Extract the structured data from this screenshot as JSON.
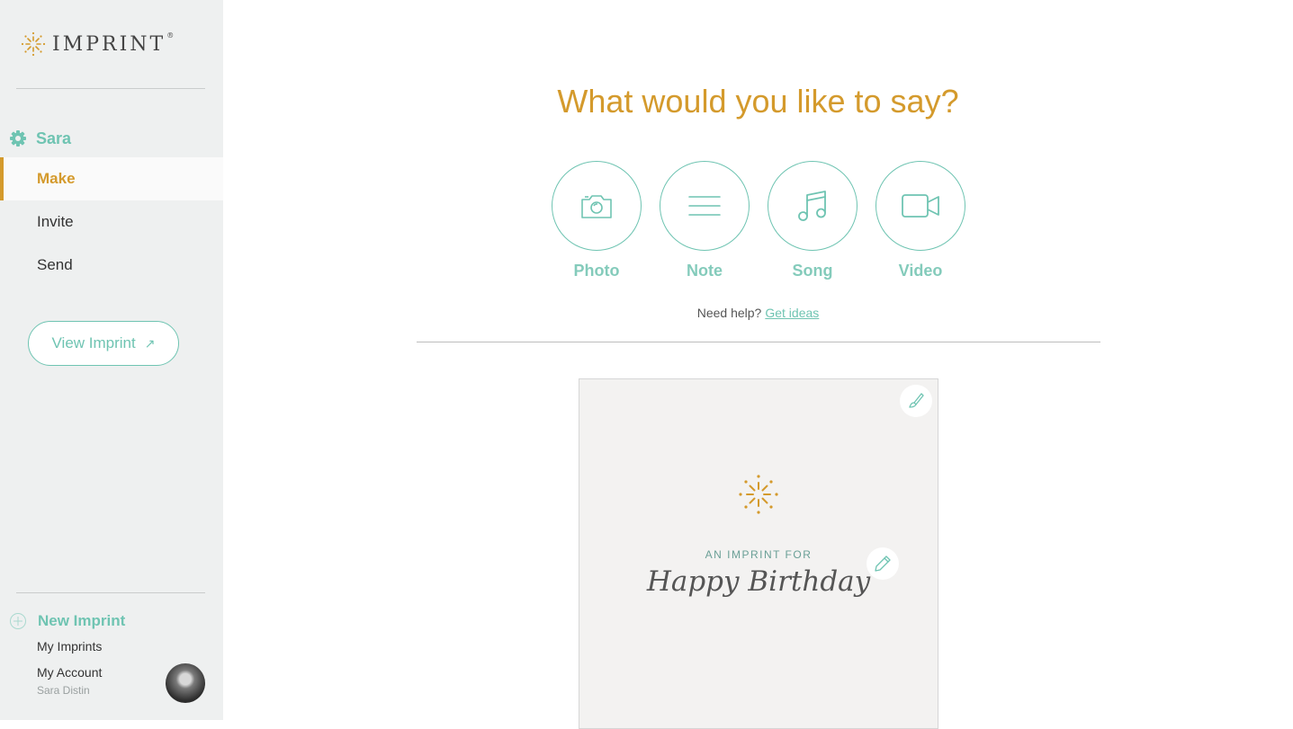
{
  "brand": {
    "name": "IMPRINT",
    "mark": "®",
    "accent": "#d49a2c",
    "teal": "#6fc4b2"
  },
  "sidebar": {
    "user_label": "Sara",
    "nav": [
      {
        "label": "Make",
        "active": true
      },
      {
        "label": "Invite",
        "active": false
      },
      {
        "label": "Send",
        "active": false
      }
    ],
    "view_button": {
      "label": "View Imprint",
      "arrow": "↗"
    },
    "footer": {
      "new_imprint": "New Imprint",
      "my_imprints": "My Imprints",
      "my_account": "My Account",
      "user_full_name": "Sara Distin"
    }
  },
  "main": {
    "title": "What would you like to say?",
    "options": [
      {
        "label": "Photo",
        "icon": "camera-icon"
      },
      {
        "label": "Note",
        "icon": "lines-icon"
      },
      {
        "label": "Song",
        "icon": "music-note-icon"
      },
      {
        "label": "Video",
        "icon": "video-camera-icon"
      }
    ],
    "help_text": "Need help?",
    "help_link": "Get ideas"
  },
  "card": {
    "kicker": "AN IMPRINT FOR",
    "title": "Happy Birthday"
  }
}
